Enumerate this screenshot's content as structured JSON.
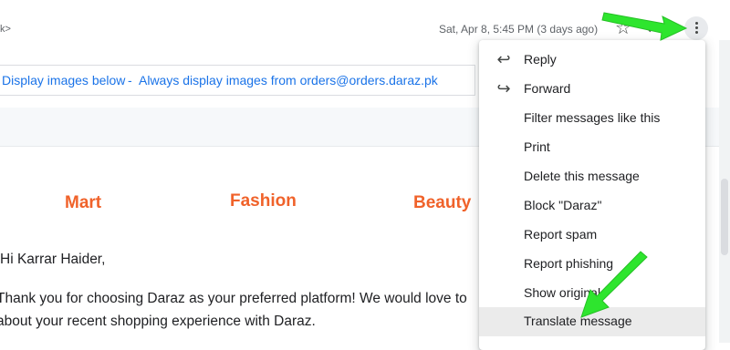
{
  "header": {
    "sender_fragment": "k>",
    "date": "Sat, Apr 8, 5:45 PM (3 days ago)",
    "icons": [
      "star-icon",
      "reply-icon",
      "more-vert-icon"
    ]
  },
  "images_bar": {
    "display_below": "Display images below",
    "separator": "-",
    "always_display": "Always display images from orders@orders.daraz.pk"
  },
  "categories": [
    "Mart",
    "Fashion",
    "Beauty"
  ],
  "body": {
    "greeting": "Hi Karrar Haider,",
    "line1": "Thank you for choosing Daraz as your preferred platform! We would love to",
    "line2": "about your recent shopping experience with Daraz."
  },
  "menu": {
    "items": [
      {
        "label": "Reply",
        "icon": "reply-icon"
      },
      {
        "label": "Forward",
        "icon": "forward-icon"
      },
      {
        "label": "Filter messages like this"
      },
      {
        "label": "Print"
      },
      {
        "label": "Delete this message"
      },
      {
        "label": "Block \"Daraz\""
      },
      {
        "label": "Report spam"
      },
      {
        "label": "Report phishing"
      },
      {
        "label": "Show original"
      },
      {
        "label": "Translate message",
        "highlighted": true
      }
    ]
  },
  "colors": {
    "link": "#1a73e8",
    "category": "#f0622a",
    "annotation_arrow": "#2ee52e",
    "highlight": "#ebebeb"
  }
}
